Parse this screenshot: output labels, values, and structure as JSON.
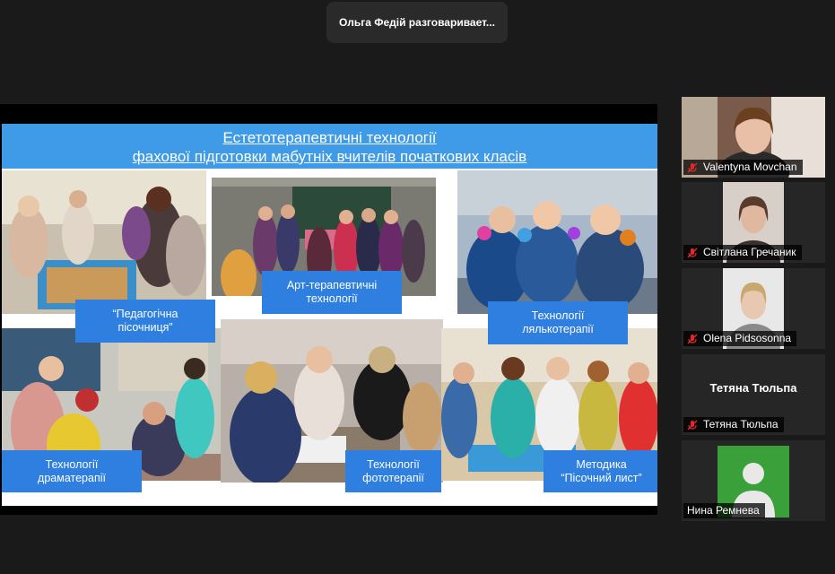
{
  "speaker_banner": "Ольга Федій разговаривает...",
  "slide": {
    "title_line1": "Естетотерапевтичні технології",
    "title_line2": "фахової підготовки мабутніх вчителів початкових класів",
    "captions": {
      "sandbox": "“Педагогічна\nпісочниця”",
      "art": "Арт-терапевтичні\nтехнології",
      "puppet": "Технології\nлялькотерапії",
      "drama": "Технології\nдраматерапії",
      "photo": "Технології\nфототерапії",
      "method": "Методика\n“Пісочний лист”"
    }
  },
  "participants": [
    {
      "name": "Valentyna Movchan",
      "muted": true,
      "video": true
    },
    {
      "name": "Світлана Гречаник",
      "muted": true,
      "video": true
    },
    {
      "name": "Olena Pidsosonna",
      "muted": true,
      "video": true
    },
    {
      "name": "Тетяна Тюльпа",
      "display": "Тетяна Тюльпа",
      "muted": true,
      "video": false
    },
    {
      "name": "Нина Ремнева",
      "muted": false,
      "video": false
    }
  ],
  "colors": {
    "title_bar": "#3f9be8",
    "caption": "#2f7fe0",
    "muted_icon": "#e02828",
    "avatar_bg": "#3aa13a"
  },
  "icons": {
    "muted": "microphone-off-icon",
    "avatar": "person-avatar-icon"
  }
}
